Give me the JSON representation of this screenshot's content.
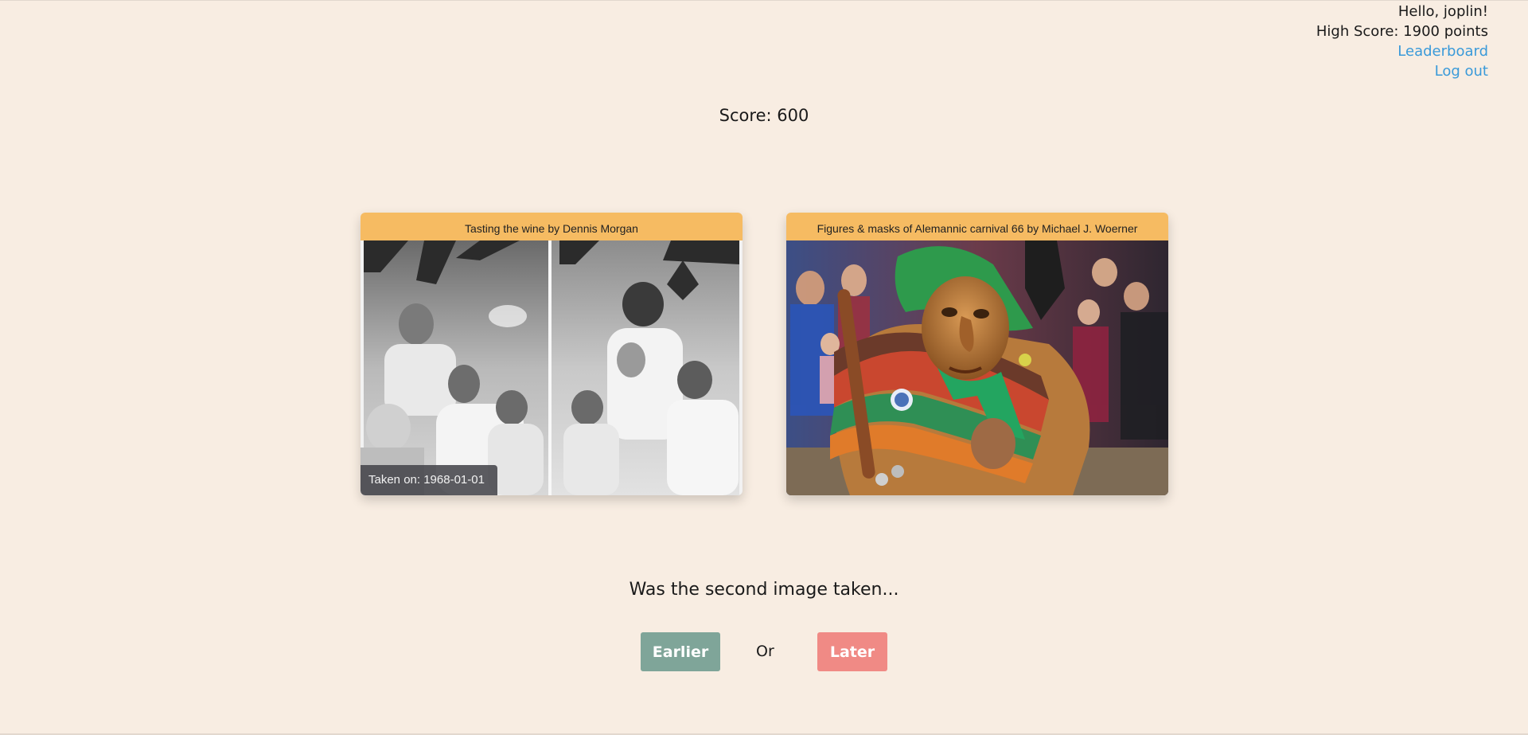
{
  "header": {
    "greeting": "Hello, joplin!",
    "high_score": "High Score: 1900 points",
    "leaderboard_link": "Leaderboard",
    "logout_link": "Log out"
  },
  "score": "Score: 600",
  "cards": [
    {
      "title": "Tasting the wine by Dennis Morgan",
      "taken_on": "Taken on: 1968-01-01",
      "image_description": "Black-and-white split photograph of people tasting wine from carafes"
    },
    {
      "title": "Figures & masks of Alemannic carnival 66 by Michael J. Woerner",
      "image_description": "Color photo of a carved wooden witch mask costume with striped knitted shawl at a carnival parade"
    }
  ],
  "question": "Was the second image taken...",
  "buttons": {
    "earlier": "Earlier",
    "or": "Or",
    "later": "Later"
  },
  "colors": {
    "background": "#f8ede2",
    "card_title_bg": "#f6bb62",
    "link": "#3a9ad9",
    "earlier_button": "#7fa599",
    "later_button": "#f08a85"
  }
}
